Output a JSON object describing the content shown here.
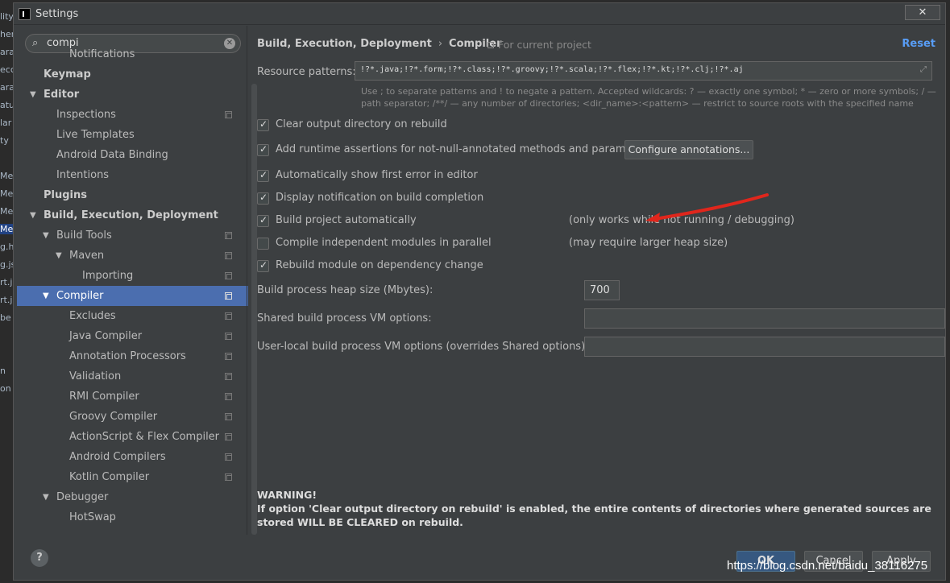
{
  "window": {
    "title": "Settings",
    "close_label": "✕"
  },
  "background_strip": [
    "lity",
    "her",
    "ara",
    "ecc",
    "ara",
    "atu",
    "lar",
    "ty",
    "",
    "Mer",
    "Mer",
    "Mer",
    "Mer",
    "g.h",
    "g.js",
    "rt.j",
    "rt.j",
    "be",
    "",
    "",
    "n",
    "on"
  ],
  "search": {
    "value": "compi"
  },
  "tree": [
    {
      "label": "Notifications",
      "indent": 3,
      "arrow": "",
      "bold": false,
      "copy": false,
      "partial": true
    },
    {
      "label": "Keymap",
      "indent": 1,
      "arrow": "",
      "bold": true,
      "copy": false
    },
    {
      "label": "Editor",
      "indent": 1,
      "arrow": "▼",
      "bold": true,
      "copy": false
    },
    {
      "label": "Inspections",
      "indent": 2,
      "arrow": "",
      "bold": false,
      "copy": true
    },
    {
      "label": "Live Templates",
      "indent": 2,
      "arrow": "",
      "bold": false,
      "copy": false
    },
    {
      "label": "Android Data Binding",
      "indent": 2,
      "arrow": "",
      "bold": false,
      "copy": false
    },
    {
      "label": "Intentions",
      "indent": 2,
      "arrow": "",
      "bold": false,
      "copy": false
    },
    {
      "label": "Plugins",
      "indent": 1,
      "arrow": "",
      "bold": true,
      "copy": false
    },
    {
      "label": "Build, Execution, Deployment",
      "indent": 1,
      "arrow": "▼",
      "bold": true,
      "copy": false
    },
    {
      "label": "Build Tools",
      "indent": 2,
      "arrow": "▼",
      "bold": false,
      "copy": true
    },
    {
      "label": "Maven",
      "indent": 3,
      "arrow": "▼",
      "bold": false,
      "copy": true
    },
    {
      "label": "Importing",
      "indent": 4,
      "arrow": "",
      "bold": false,
      "copy": true
    },
    {
      "label": "Compiler",
      "indent": 2,
      "arrow": "▼",
      "bold": false,
      "copy": true,
      "selected": true
    },
    {
      "label": "Excludes",
      "indent": 3,
      "arrow": "",
      "bold": false,
      "copy": true
    },
    {
      "label": "Java Compiler",
      "indent": 3,
      "arrow": "",
      "bold": false,
      "copy": true
    },
    {
      "label": "Annotation Processors",
      "indent": 3,
      "arrow": "",
      "bold": false,
      "copy": true
    },
    {
      "label": "Validation",
      "indent": 3,
      "arrow": "",
      "bold": false,
      "copy": true
    },
    {
      "label": "RMI Compiler",
      "indent": 3,
      "arrow": "",
      "bold": false,
      "copy": true
    },
    {
      "label": "Groovy Compiler",
      "indent": 3,
      "arrow": "",
      "bold": false,
      "copy": true
    },
    {
      "label": "ActionScript & Flex Compiler",
      "indent": 3,
      "arrow": "",
      "bold": false,
      "copy": true
    },
    {
      "label": "Android Compilers",
      "indent": 3,
      "arrow": "",
      "bold": false,
      "copy": true
    },
    {
      "label": "Kotlin Compiler",
      "indent": 3,
      "arrow": "",
      "bold": false,
      "copy": true
    },
    {
      "label": "Debugger",
      "indent": 2,
      "arrow": "▼",
      "bold": false,
      "copy": false
    },
    {
      "label": "HotSwap",
      "indent": 3,
      "arrow": "",
      "bold": false,
      "copy": false
    }
  ],
  "breadcrumb": {
    "parent": "Build, Execution, Deployment",
    "separator": "›",
    "current": "Compiler"
  },
  "scope": "For current project",
  "reset_label": "Reset",
  "resource_patterns": {
    "label": "Resource patterns:",
    "value": "!?*.java;!?*.form;!?*.class;!?*.groovy;!?*.scala;!?*.flex;!?*.kt;!?*.clj;!?*.aj",
    "hint": "Use ; to separate patterns and ! to negate a pattern. Accepted wildcards: ? — exactly one symbol; * — zero or more symbols; / — path separator; /**/ — any number of directories; <dir_name>:<pattern> — restrict to source roots with the specified name"
  },
  "options": [
    {
      "label": "Clear output directory on rebuild",
      "checked": true,
      "note": ""
    },
    {
      "label": "Add runtime assertions for not-null-annotated methods and parameters",
      "checked": true,
      "note": ""
    },
    {
      "label": "Automatically show first error in editor",
      "checked": true,
      "note": ""
    },
    {
      "label": "Display notification on build completion",
      "checked": true,
      "note": ""
    },
    {
      "label": "Build project automatically",
      "checked": true,
      "note": "(only works while not running / debugging)"
    },
    {
      "label": "Compile independent modules in parallel",
      "checked": false,
      "note": "(may require larger heap size)"
    },
    {
      "label": "Rebuild module on dependency change",
      "checked": true,
      "note": ""
    }
  ],
  "configure_annotations_label": "Configure annotations...",
  "heap": {
    "label": "Build process heap size (Mbytes):",
    "value": "700"
  },
  "shared_vm": {
    "label": "Shared build process VM options:",
    "value": ""
  },
  "user_vm": {
    "label": "User-local build process VM options (overrides Shared options):",
    "value": ""
  },
  "warning": {
    "title": "WARNING!",
    "text": "If option 'Clear output directory on rebuild' is enabled, the entire contents of directories where generated sources are stored WILL BE CLEARED on rebuild."
  },
  "buttons": {
    "help": "?",
    "ok": "OK",
    "cancel": "Cancel",
    "apply": "Apply"
  },
  "watermark": "https://blog.csdn.net/baidu_38116275",
  "colors": {
    "selection": "#4b6eaf",
    "link": "#589df6",
    "annotation_arrow": "#e0261c"
  }
}
